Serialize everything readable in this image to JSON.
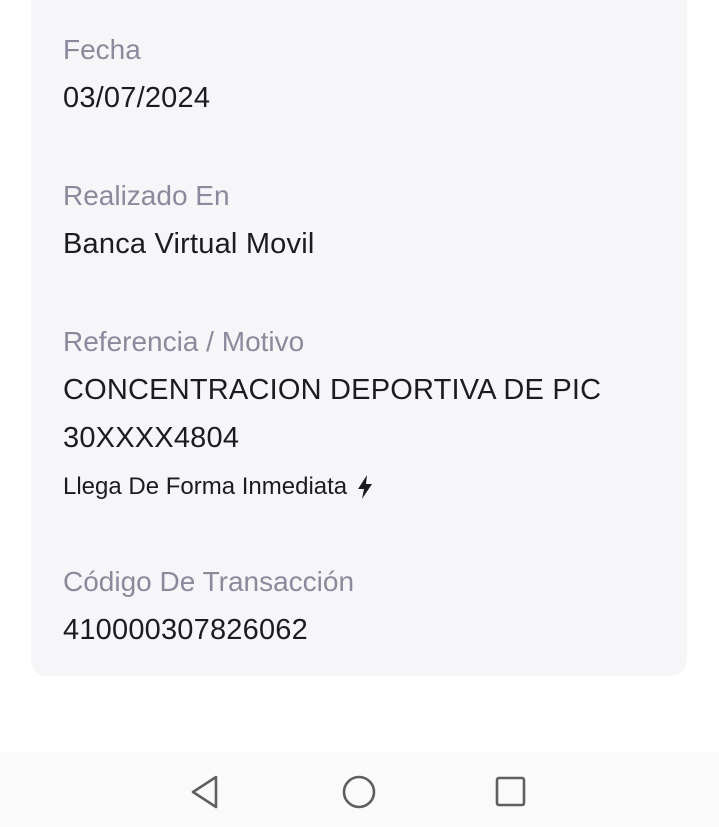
{
  "details": {
    "fecha": {
      "label": "Fecha",
      "value": "03/07/2024"
    },
    "realizado_en": {
      "label": "Realizado En",
      "value": "Banca Virtual Movil"
    },
    "referencia": {
      "label": "Referencia / Motivo",
      "value_line1": "CONCENTRACION DEPORTIVA DE PIC",
      "value_line2": "30XXXX4804",
      "note": "Llega De Forma Inmediata",
      "note_icon": "lightning-bolt-icon"
    },
    "codigo": {
      "label": "Código De Transacción",
      "value": "410000307826062"
    }
  },
  "navbar": {
    "icons": [
      "back-triangle-icon",
      "home-circle-icon",
      "recents-square-icon"
    ],
    "color": "#5f5f5f"
  },
  "colors": {
    "card_background": "#f6f6f9",
    "label": "#8b8a9c",
    "value": "#1c1c1f"
  }
}
